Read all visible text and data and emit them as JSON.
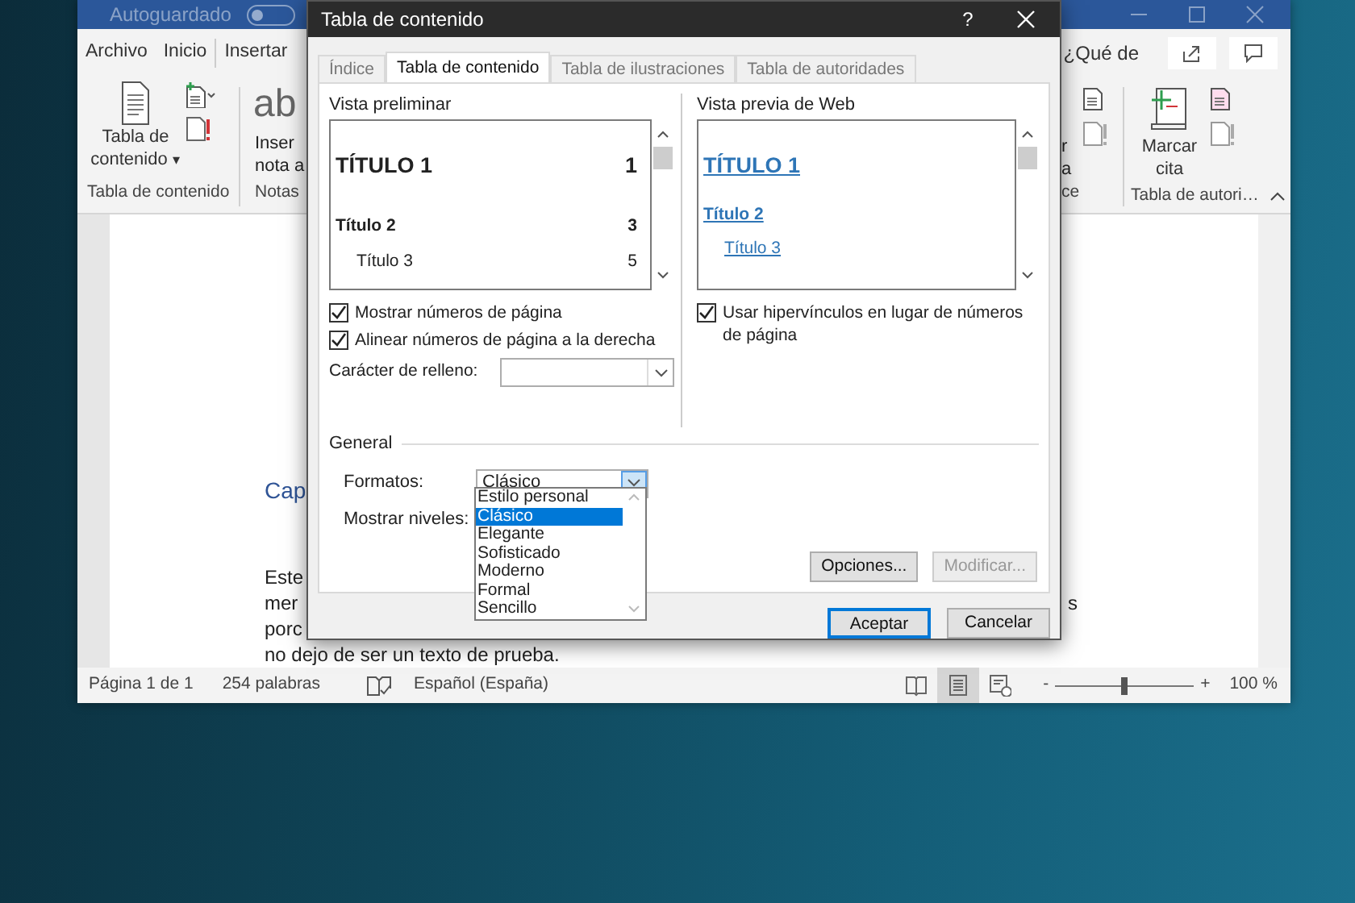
{
  "word": {
    "title_bar": {
      "autosave_label": "Autoguardado",
      "autosave_on": false
    },
    "ribbon_tabs": [
      {
        "label": "Archivo"
      },
      {
        "label": "Inicio"
      },
      {
        "label": "Insertar"
      }
    ],
    "tell_me": "¿Qué de",
    "ribbon_left": {
      "toc_button": "Tabla de contenido",
      "toc_caret": "▾",
      "group_label": "Tabla de contenido",
      "partial_big": "ab",
      "partial_lines": [
        "Inser",
        "nota a"
      ],
      "partial_group": "Notas"
    },
    "ribbon_right": {
      "partial_lines": [
        "r",
        "a"
      ],
      "partial_group": "ce",
      "cite_button": "Marcar cita",
      "group_label": "Tabla de autori…"
    },
    "document": {
      "heading": "Cap",
      "lines": [
        {
          "text": "Este"
        },
        {
          "text": "mer",
          "tail": "s"
        },
        {
          "text": "porc"
        },
        {
          "text": "no dejo de ser un texto de prueba."
        }
      ]
    },
    "status_bar": {
      "page": "Página 1 de 1",
      "words": "254 palabras",
      "language": "Español (España)",
      "views": [
        {
          "kind": "read",
          "selected": false
        },
        {
          "kind": "print",
          "selected": true
        },
        {
          "kind": "web",
          "selected": false
        }
      ],
      "zoom_minus": "-",
      "zoom_plus": "+",
      "zoom": {
        "level": 0.5
      },
      "zoom_text": "100 %"
    }
  },
  "dialog": {
    "title": "Tabla de contenido",
    "help": "?",
    "tabs": [
      {
        "label": "Índice",
        "selected": false
      },
      {
        "label": "Tabla de contenido",
        "selected": true
      },
      {
        "label": "Tabla de ilustraciones",
        "selected": false
      },
      {
        "label": "Tabla de autoridades",
        "selected": false
      }
    ],
    "print_preview": {
      "label": "Vista preliminar",
      "entries": [
        {
          "kind": "h1",
          "text": "TÍTULO 1",
          "page": "1"
        },
        {
          "kind": "h2",
          "text": "Título 2",
          "page": "3"
        },
        {
          "kind": "h3",
          "text": "Título 3",
          "page": "5"
        }
      ]
    },
    "web_preview": {
      "label": "Vista previa de Web",
      "entries": [
        {
          "kind": "h1",
          "text": "TÍTULO 1"
        },
        {
          "kind": "h2",
          "text": "Título 2"
        },
        {
          "kind": "h3",
          "text": "Título 3"
        }
      ]
    },
    "options": [
      {
        "label": "Mostrar números de página",
        "checked": true
      },
      {
        "label": "Alinear números de página a la derecha",
        "checked": true
      }
    ],
    "leader": {
      "label": "Carácter de relleno:"
    },
    "web_option": {
      "label": "Usar hipervínculos en lugar de números de página",
      "checked": true
    },
    "general": {
      "label": "General",
      "formats_label": "Formatos:",
      "formats_value": "Clásico",
      "expanded": true,
      "formats_options": [
        {
          "label": "Estilo personal",
          "selected": false
        },
        {
          "label": "Clásico",
          "selected": true
        },
        {
          "label": "Elegante",
          "selected": false
        },
        {
          "label": "Sofisticado",
          "selected": false
        },
        {
          "label": "Moderno",
          "selected": false
        },
        {
          "label": "Formal",
          "selected": false
        },
        {
          "label": "Sencillo",
          "selected": false
        }
      ],
      "levels_label": "Mostrar niveles:"
    },
    "buttons": [
      {
        "label": "Opciones...",
        "disabled": false
      },
      {
        "label": "Modificar...",
        "disabled": true
      }
    ],
    "footer_buttons": [
      {
        "label": "Aceptar",
        "default": true
      },
      {
        "label": "Cancelar",
        "default": false
      }
    ]
  }
}
